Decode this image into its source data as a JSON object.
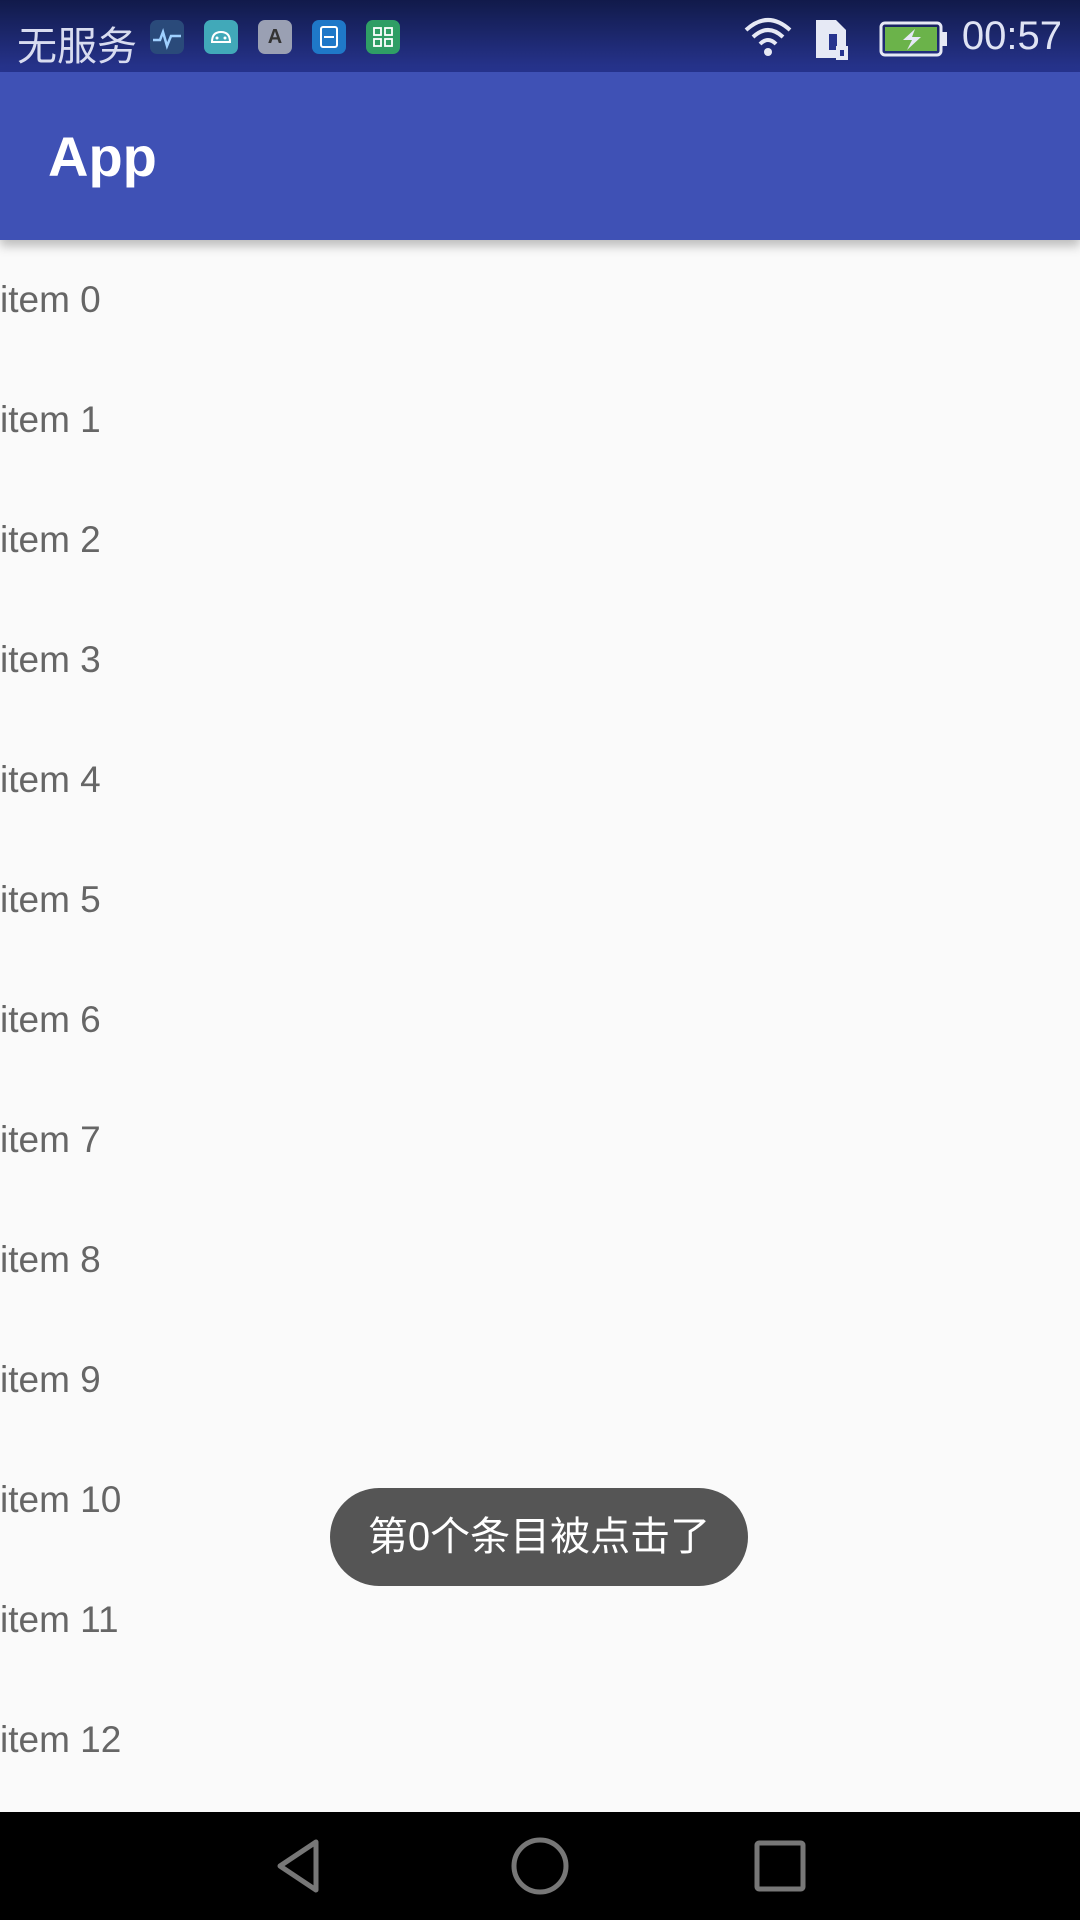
{
  "status_bar": {
    "carrier": "无服务",
    "time": "00:57",
    "notification_icons": [
      {
        "name": "health-icon",
        "color": "#2a4a7a",
        "glyph": "♥"
      },
      {
        "name": "android-icon",
        "color": "#41a9b9",
        "glyph": "⌂"
      },
      {
        "name": "font-a-icon",
        "color": "#9aa0b3",
        "glyph": "A"
      },
      {
        "name": "card-icon",
        "color": "#1f78c8",
        "glyph": "▭"
      },
      {
        "name": "apps-grid-icon",
        "color": "#2f9e65",
        "glyph": "▦"
      }
    ],
    "battery_color": "#6bb34a"
  },
  "app_bar": {
    "title": "App",
    "color": "#3f51b5"
  },
  "list": {
    "items": [
      "item 0",
      "item 1",
      "item 2",
      "item 3",
      "item 4",
      "item 5",
      "item 6",
      "item 7",
      "item 8",
      "item 9",
      "item 10",
      "item 11",
      "item 12"
    ]
  },
  "toast": {
    "message": "第0个条目被点击了"
  },
  "nav_bar": {
    "back": "back-icon",
    "home": "home-icon",
    "recents": "recents-icon"
  }
}
